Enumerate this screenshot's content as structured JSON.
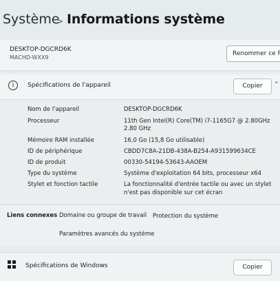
{
  "breadcrumb": {
    "parent": "Système",
    "separator": ">",
    "current": "Informations système"
  },
  "device": {
    "name": "DESKTOP-DGCRD6K",
    "model": "MACHD-WXX9",
    "rename_label": "Renommer ce PC"
  },
  "device_specs": {
    "title": "Spécifications de l'appareil",
    "copy_label": "Copier",
    "rows": [
      {
        "label": "Nom de l'appareil",
        "value": "DESKTOP-DGCRD6K"
      },
      {
        "label": "Processeur",
        "value": "11th Gen Intel(R) Core(TM) i7-1165G7 @ 2.80GHz",
        "value2": "2.80 GHz"
      },
      {
        "label": "Mémoire RAM installée",
        "value": "16,0 Go (15,8 Go utilisable)"
      },
      {
        "label": "ID de périphérique",
        "value": "CBDD7C8A-21DB-438A-B254-A931599634CE"
      },
      {
        "label": "ID de produit",
        "value": "00330-54194-53643-AAOEM"
      },
      {
        "label": "Type du système",
        "value": "Système d'exploitation 64 bits, processeur x64"
      },
      {
        "label": "Stylet et fonction tactile",
        "value": "La fonctionnalité d'entrée tactile ou avec un stylet",
        "value2": "n'est pas disponible sur cet écran"
      }
    ]
  },
  "related_links": {
    "title": "Liens connexes",
    "items": [
      "Domaine ou groupe de travail",
      "Protection du système",
      "Paramètres avancés du système"
    ]
  },
  "windows_specs": {
    "title": "Spécifications de Windows",
    "copy_label": "Copier"
  }
}
